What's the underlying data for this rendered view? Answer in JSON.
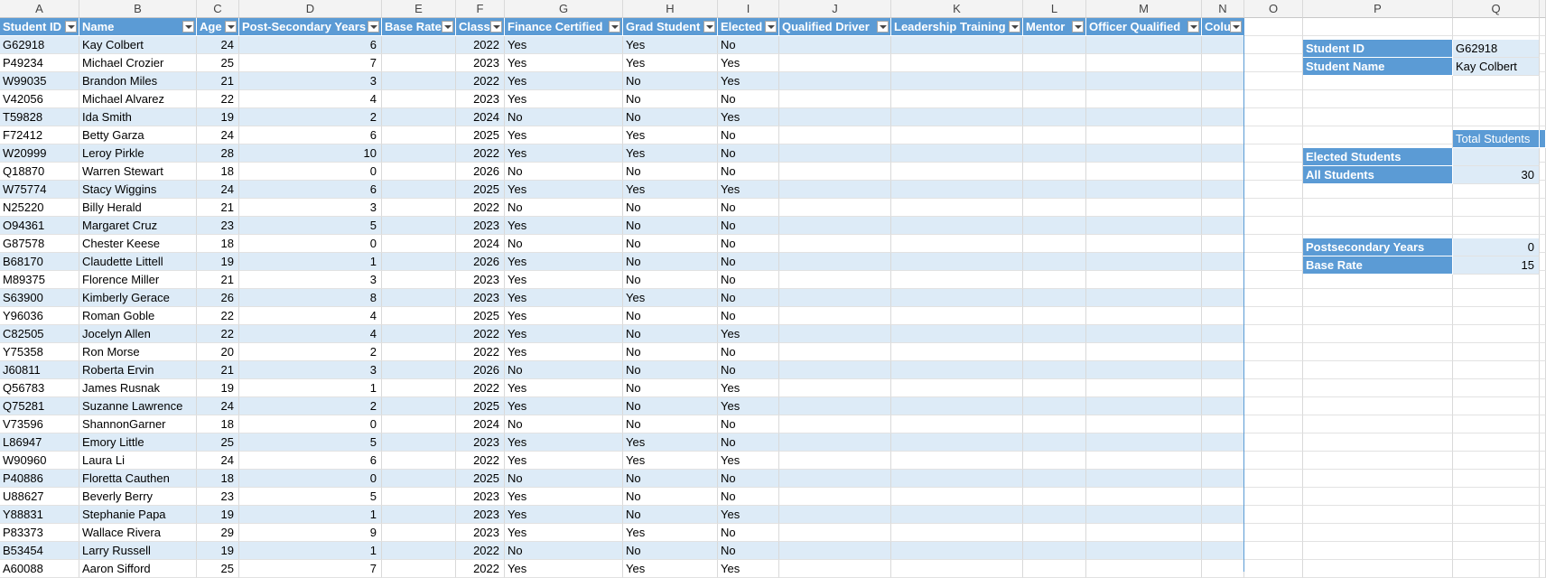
{
  "col_letters": [
    "A",
    "B",
    "C",
    "D",
    "E",
    "F",
    "G",
    "H",
    "I",
    "J",
    "K",
    "L",
    "M",
    "N",
    "O",
    "P",
    "Q"
  ],
  "table": {
    "headers": [
      "Student ID",
      "Name",
      "Age",
      "Post-Secondary Years",
      "Base Rate",
      "Class",
      "Finance Certified",
      "Grad Student",
      "Elected",
      "Qualified Driver",
      "Leadership Training",
      "Mentor",
      "Officer Qualified",
      "Colu"
    ],
    "rows": [
      [
        "G62918",
        "Kay Colbert",
        "24",
        "6",
        "",
        "2022",
        "Yes",
        "Yes",
        "No"
      ],
      [
        "P49234",
        "Michael Crozier",
        "25",
        "7",
        "",
        "2023",
        "Yes",
        "Yes",
        "Yes"
      ],
      [
        "W99035",
        "Brandon Miles",
        "21",
        "3",
        "",
        "2022",
        "Yes",
        "No",
        "Yes"
      ],
      [
        "V42056",
        "Michael Alvarez",
        "22",
        "4",
        "",
        "2023",
        "Yes",
        "No",
        "No"
      ],
      [
        "T59828",
        "Ida Smith",
        "19",
        "2",
        "",
        "2024",
        "No",
        "No",
        "Yes"
      ],
      [
        "F72412",
        "Betty Garza",
        "24",
        "6",
        "",
        "2025",
        "Yes",
        "Yes",
        "No"
      ],
      [
        "W20999",
        "Leroy Pirkle",
        "28",
        "10",
        "",
        "2022",
        "Yes",
        "Yes",
        "No"
      ],
      [
        "Q18870",
        "Warren Stewart",
        "18",
        "0",
        "",
        "2026",
        "No",
        "No",
        "No"
      ],
      [
        "W75774",
        "Stacy Wiggins",
        "24",
        "6",
        "",
        "2025",
        "Yes",
        "Yes",
        "Yes"
      ],
      [
        "N25220",
        "Billy Herald",
        "21",
        "3",
        "",
        "2022",
        "No",
        "No",
        "No"
      ],
      [
        "O94361",
        "Margaret Cruz",
        "23",
        "5",
        "",
        "2023",
        "Yes",
        "No",
        "No"
      ],
      [
        "G87578",
        "Chester Keese",
        "18",
        "0",
        "",
        "2024",
        "No",
        "No",
        "No"
      ],
      [
        "B68170",
        "Claudette Littell",
        "19",
        "1",
        "",
        "2026",
        "Yes",
        "No",
        "No"
      ],
      [
        "M89375",
        "Florence Miller",
        "21",
        "3",
        "",
        "2023",
        "Yes",
        "No",
        "No"
      ],
      [
        "S63900",
        "Kimberly Gerace",
        "26",
        "8",
        "",
        "2023",
        "Yes",
        "Yes",
        "No"
      ],
      [
        "Y96036",
        "Roman Goble",
        "22",
        "4",
        "",
        "2025",
        "Yes",
        "No",
        "No"
      ],
      [
        "C82505",
        "Jocelyn Allen",
        "22",
        "4",
        "",
        "2022",
        "Yes",
        "No",
        "Yes"
      ],
      [
        "Y75358",
        "Ron Morse",
        "20",
        "2",
        "",
        "2022",
        "Yes",
        "No",
        "No"
      ],
      [
        "J60811",
        "Roberta Ervin",
        "21",
        "3",
        "",
        "2026",
        "No",
        "No",
        "No"
      ],
      [
        "Q56783",
        "James Rusnak",
        "19",
        "1",
        "",
        "2022",
        "Yes",
        "No",
        "Yes"
      ],
      [
        "Q75281",
        "Suzanne Lawrence",
        "24",
        "2",
        "",
        "2025",
        "Yes",
        "No",
        "Yes"
      ],
      [
        "V73596",
        "ShannonGarner",
        "18",
        "0",
        "",
        "2024",
        "No",
        "No",
        "No"
      ],
      [
        "L86947",
        "Emory Little",
        "25",
        "5",
        "",
        "2023",
        "Yes",
        "Yes",
        "No"
      ],
      [
        "W90960",
        "Laura Li",
        "24",
        "6",
        "",
        "2022",
        "Yes",
        "Yes",
        "Yes"
      ],
      [
        "P40886",
        "Floretta Cauthen",
        "18",
        "0",
        "",
        "2025",
        "No",
        "No",
        "No"
      ],
      [
        "U88627",
        "Beverly Berry",
        "23",
        "5",
        "",
        "2023",
        "Yes",
        "No",
        "No"
      ],
      [
        "Y88831",
        "Stephanie Papa",
        "19",
        "1",
        "",
        "2023",
        "Yes",
        "No",
        "Yes"
      ],
      [
        "P83373",
        "Wallace Rivera",
        "29",
        "9",
        "",
        "2023",
        "Yes",
        "Yes",
        "No"
      ],
      [
        "B53454",
        "Larry Russell",
        "19",
        "1",
        "",
        "2022",
        "No",
        "No",
        "No"
      ],
      [
        "A60088",
        "Aaron Sifford",
        "25",
        "7",
        "",
        "2022",
        "Yes",
        "Yes",
        "Yes"
      ]
    ]
  },
  "panel": {
    "student_id_label": "Student ID",
    "student_id_value": "G62918",
    "student_name_label": "Student Name",
    "student_name_value": "Kay Colbert",
    "total_students_label": "Total Students",
    "elected_label": "Elected Students",
    "elected_value": "",
    "all_label": "All Students",
    "all_value": "30",
    "postsecondary_label": "Postsecondary Years",
    "postsecondary_value": "0",
    "base_rate_label": "Base Rate",
    "base_rate_value": "15"
  },
  "colors": {
    "header_blue": "#5b9bd5",
    "band_blue": "#ddebf7"
  }
}
